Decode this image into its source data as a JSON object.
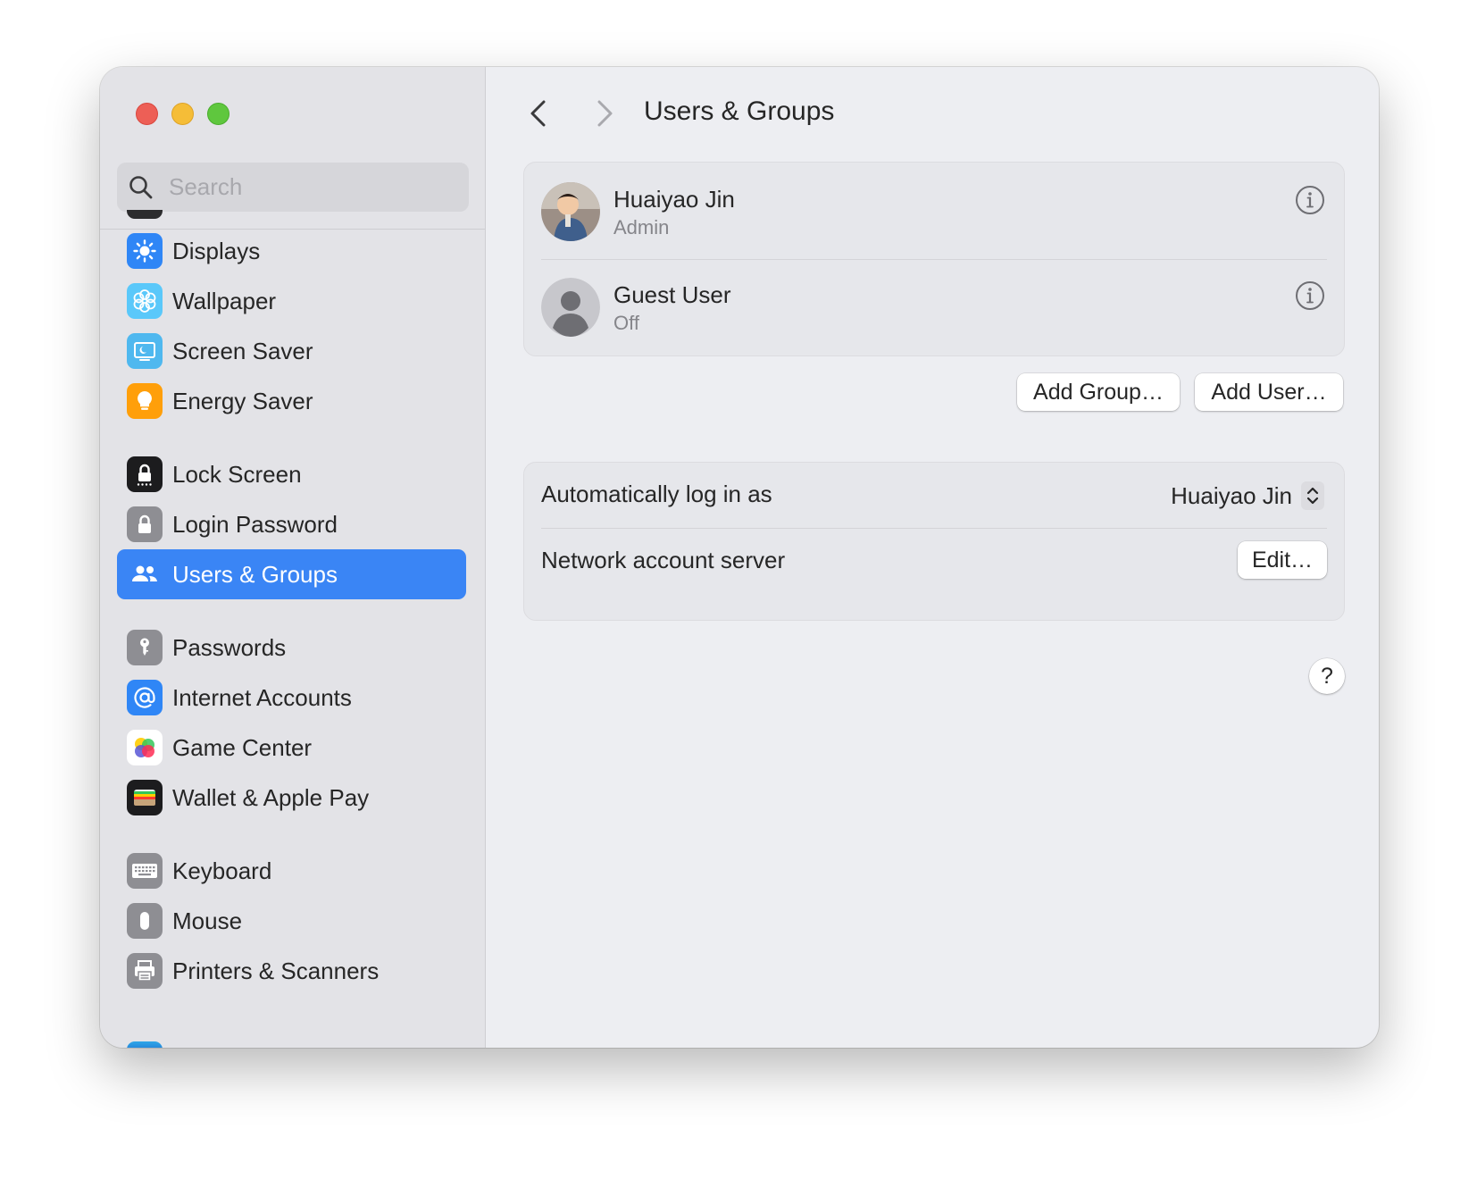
{
  "window": {
    "traffic_lights": [
      "close",
      "minimize",
      "zoom"
    ]
  },
  "search": {
    "placeholder": "Search",
    "value": ""
  },
  "sidebar": {
    "selected": "Users & Groups",
    "items": [
      {
        "label": "Displays",
        "icon": "sun-icon",
        "color": "#2f86f6"
      },
      {
        "label": "Wallpaper",
        "icon": "flower-icon",
        "color": "#5ac8fa"
      },
      {
        "label": "Screen Saver",
        "icon": "screen-saver-icon",
        "color": "#4fb8ef"
      },
      {
        "label": "Energy Saver",
        "icon": "lightbulb-icon",
        "color": "#ff9f0a"
      },
      {
        "label": "Lock Screen",
        "icon": "lock-screen-icon",
        "color": "#1c1c1e"
      },
      {
        "label": "Login Password",
        "icon": "lock-icon",
        "color": "#8e8e93"
      },
      {
        "label": "Users & Groups",
        "icon": "users-icon",
        "color": "#2f86f6"
      },
      {
        "label": "Passwords",
        "icon": "key-icon",
        "color": "#8e8e93"
      },
      {
        "label": "Internet Accounts",
        "icon": "at-icon",
        "color": "#2f86f6"
      },
      {
        "label": "Game Center",
        "icon": "game-center-icon",
        "color": "#ffffff"
      },
      {
        "label": "Wallet & Apple Pay",
        "icon": "wallet-icon",
        "color": "#1c1c1e"
      },
      {
        "label": "Keyboard",
        "icon": "keyboard-icon",
        "color": "#8e8e93"
      },
      {
        "label": "Mouse",
        "icon": "mouse-icon",
        "color": "#8e8e93"
      },
      {
        "label": "Printers & Scanners",
        "icon": "printer-icon",
        "color": "#8e8e93"
      }
    ]
  },
  "main": {
    "title": "Users & Groups",
    "users": [
      {
        "name": "Huaiyao Jin",
        "role": "Admin",
        "avatar": "photo-avatar"
      },
      {
        "name": "Guest User",
        "role": "Off",
        "avatar": "generic-person-avatar"
      }
    ],
    "buttons": {
      "add_group": "Add Group…",
      "add_user": "Add User…"
    },
    "settings": {
      "auto_login_label": "Automatically log in as",
      "auto_login_value": "Huaiyao Jin",
      "network_label": "Network account server",
      "network_button": "Edit…"
    },
    "help_label": "?"
  },
  "colors": {
    "accent": "#3a85f5",
    "sidebar_bg": "#e3e3e7",
    "content_bg": "#edeef2"
  }
}
